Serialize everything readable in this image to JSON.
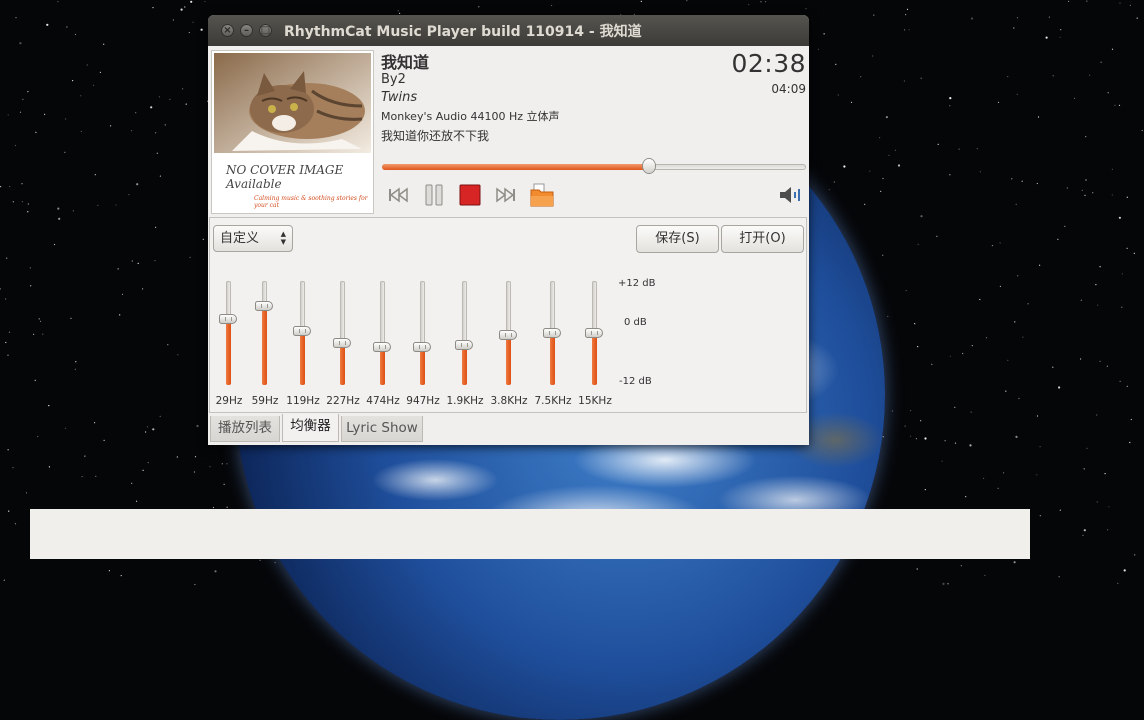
{
  "window": {
    "title": "RhythmCat Music Player build 110914 - 我知道",
    "buttons": [
      "close",
      "minimize",
      "maximize"
    ]
  },
  "cover": {
    "text_line1": "NO COVER IMAGE",
    "text_line2": "Available",
    "tagline": "Calming music & soothing stories for your cat"
  },
  "track": {
    "title": "我知道",
    "artist": "By2",
    "album": "Twins",
    "format": "Monkey's Audio 44100 Hz 立体声",
    "lyric": "我知道你还放不下我",
    "elapsed": "02:38",
    "total": "04:09",
    "progress": 0.63
  },
  "controls": [
    "previous-icon",
    "pause-icon",
    "stop-icon",
    "next-icon",
    "open-folder-icon",
    "volume-icon"
  ],
  "equalizer": {
    "preset": "自定义",
    "save_label": "保存(S)",
    "open_label": "打开(O)",
    "db_max": "+12 dB",
    "db_mid": "0 dB",
    "db_min": "-12 dB",
    "bands": [
      {
        "label": "29Hz",
        "gain_db": 3.2
      },
      {
        "label": "59Hz",
        "gain_db": 6.2
      },
      {
        "label": "119Hz",
        "gain_db": 0.5
      },
      {
        "label": "227Hz",
        "gain_db": -2.3
      },
      {
        "label": "474Hz",
        "gain_db": -3.2
      },
      {
        "label": "947Hz",
        "gain_db": -3.2
      },
      {
        "label": "1.9KHz",
        "gain_db": -2.7
      },
      {
        "label": "3.8KHz",
        "gain_db": -0.5
      },
      {
        "label": "7.5KHz",
        "gain_db": 0.0
      },
      {
        "label": "15KHz",
        "gain_db": 0.0
      }
    ]
  },
  "tabs": [
    {
      "label": "播放列表",
      "active": false
    },
    {
      "label": "均衡器",
      "active": true
    },
    {
      "label": "Lyric Show",
      "active": false
    }
  ],
  "colors": {
    "accent": "#e0561d",
    "titlebar": "#3c3b37"
  }
}
